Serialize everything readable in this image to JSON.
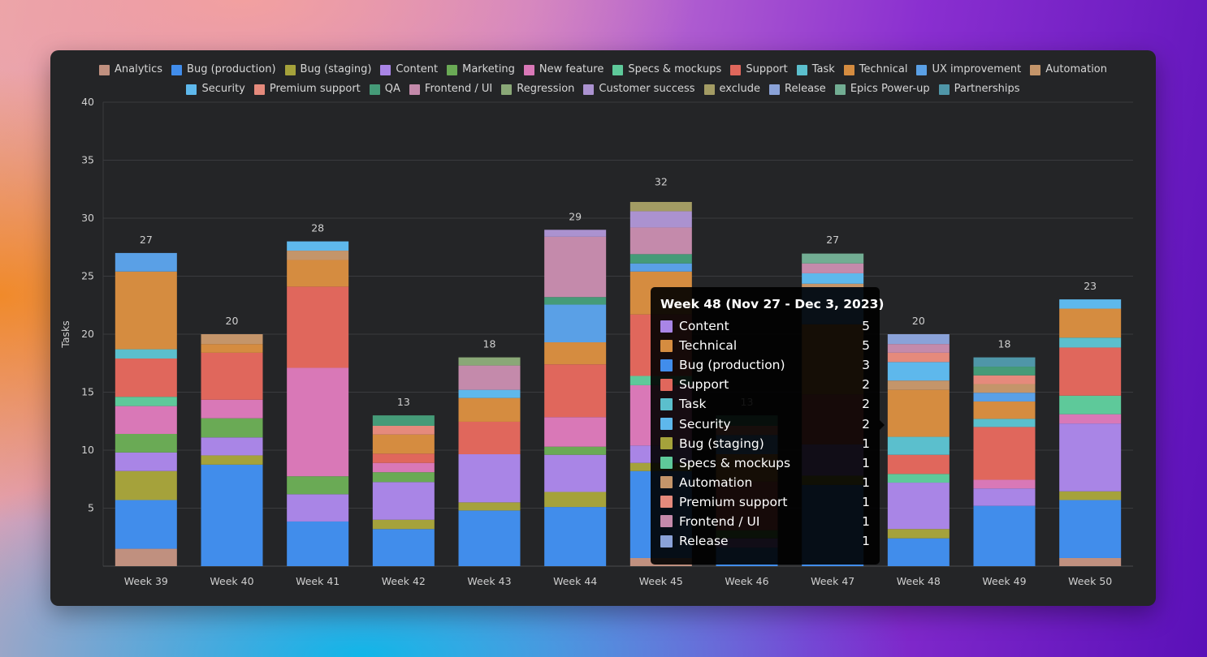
{
  "chart_data": {
    "type": "bar",
    "stacked": true,
    "ylabel": "Tasks",
    "ylim": [
      0,
      40
    ],
    "yticks": [
      5,
      10,
      15,
      20,
      25,
      30,
      35,
      40
    ],
    "grid": true,
    "legend_position": "top",
    "categories": [
      "Week 39",
      "Week 40",
      "Week 41",
      "Week 42",
      "Week 43",
      "Week 44",
      "Week 45",
      "Week 46",
      "Week 47",
      "Week 48",
      "Week 49",
      "Week 50"
    ],
    "totals": [
      27,
      20,
      28,
      13,
      18,
      29,
      32,
      13,
      27,
      20,
      18,
      23
    ],
    "series": [
      {
        "name": "Analytics",
        "color": "#c0907f",
        "values": [
          1.5,
          0,
          0,
          0,
          0,
          0,
          0.7,
          0,
          0,
          0,
          0,
          0.7
        ]
      },
      {
        "name": "Bug (production)",
        "color": "#418deb",
        "values": [
          4.2,
          8.75,
          3.85,
          3.2,
          4.8,
          5.1,
          7.5,
          1.6,
          7.0,
          2.4,
          5.2,
          5.0
        ]
      },
      {
        "name": "Bug (staging)",
        "color": "#a5a23b",
        "values": [
          2.5,
          0.8,
          0,
          0.8,
          0.7,
          1.3,
          0.7,
          0,
          0.8,
          0.8,
          0,
          0.75
        ]
      },
      {
        "name": "Content",
        "color": "#a985e6",
        "values": [
          1.6,
          1.55,
          2.35,
          3.25,
          4.15,
          3.2,
          1.5,
          0.8,
          2.7,
          4.0,
          1.5,
          5.85
        ]
      },
      {
        "name": "Marketing",
        "color": "#6aaa55",
        "values": [
          1.6,
          1.65,
          1.55,
          0.85,
          0,
          0.7,
          0,
          0.7,
          0,
          0,
          0,
          0
        ]
      },
      {
        "name": "New feature",
        "color": "#d978b7",
        "values": [
          2.4,
          1.6,
          9.35,
          0.8,
          0,
          2.55,
          5.2,
          0,
          0,
          0,
          0.75,
          0.8
        ]
      },
      {
        "name": "Specs & mockups",
        "color": "#5ec99a",
        "values": [
          0.8,
          0,
          0,
          0,
          0,
          0,
          0.8,
          0,
          0,
          0.75,
          0,
          1.6
        ]
      },
      {
        "name": "Support",
        "color": "#e0675c",
        "values": [
          3.3,
          4.05,
          7.0,
          0.8,
          2.8,
          4.55,
          5.3,
          4.2,
          4.3,
          1.65,
          4.55,
          4.15
        ]
      },
      {
        "name": "Task",
        "color": "#5bbfcd",
        "values": [
          0.8,
          0,
          0,
          0,
          0,
          0,
          0,
          0,
          0,
          1.55,
          0.7,
          0.85
        ]
      },
      {
        "name": "Technical",
        "color": "#d58c40",
        "values": [
          6.7,
          0.75,
          2.3,
          1.65,
          2.05,
          1.9,
          3.7,
          2.35,
          6.05,
          4.05,
          1.5,
          2.5
        ]
      },
      {
        "name": "UX improvement",
        "color": "#5aa0e6",
        "values": [
          1.6,
          0,
          0,
          0,
          0,
          3.25,
          0.7,
          1.65,
          3.2,
          0,
          0.75,
          0
        ]
      },
      {
        "name": "Automation",
        "color": "#c4956a",
        "values": [
          0,
          0.85,
          0.8,
          0,
          0,
          0,
          0,
          0,
          0.3,
          0.8,
          0.75,
          0
        ]
      },
      {
        "name": "Security",
        "color": "#5eb8ec",
        "values": [
          0,
          0,
          0.8,
          0,
          0.7,
          0,
          0,
          0,
          0.9,
          1.6,
          0,
          0.8
        ]
      },
      {
        "name": "Premium support",
        "color": "#e58a7c",
        "values": [
          0,
          0,
          0,
          0.75,
          0,
          0,
          0,
          0.8,
          0,
          0.8,
          0.75,
          0
        ]
      },
      {
        "name": "QA",
        "color": "#459b78",
        "values": [
          0,
          0,
          0,
          0.9,
          0,
          0.65,
          0.8,
          0.9,
          0,
          0,
          0.75,
          0
        ]
      },
      {
        "name": "Frontend / UI",
        "color": "#c48aab",
        "values": [
          0,
          0,
          0,
          0,
          2.1,
          5.2,
          2.3,
          0,
          0.85,
          0.75,
          0,
          0
        ]
      },
      {
        "name": "Regression",
        "color": "#8aa877",
        "values": [
          0,
          0,
          0,
          0,
          0.7,
          0,
          0,
          0,
          0,
          0,
          0,
          0
        ]
      },
      {
        "name": "Customer success",
        "color": "#ab92d0",
        "values": [
          0,
          0,
          0,
          0,
          0,
          0.6,
          1.4,
          0,
          0,
          0,
          0,
          0
        ]
      },
      {
        "name": "exclude",
        "color": "#a39c64",
        "values": [
          0,
          0,
          0,
          0,
          0,
          0,
          0.8,
          0,
          0,
          0,
          0,
          0
        ]
      },
      {
        "name": "Release",
        "color": "#8aa2d8",
        "values": [
          0,
          0,
          0,
          0,
          0,
          0,
          0,
          0,
          0,
          0.85,
          0,
          0
        ]
      },
      {
        "name": "Epics Power-up",
        "color": "#72ad93",
        "values": [
          0,
          0,
          0,
          0,
          0,
          0,
          0,
          0,
          0.85,
          0,
          0,
          0
        ]
      },
      {
        "name": "Partnerships",
        "color": "#4f96a8",
        "values": [
          0,
          0,
          0,
          0,
          0,
          0,
          0,
          0,
          0,
          0,
          0.8,
          0
        ]
      }
    ]
  },
  "legend": {
    "row1": [
      "Analytics",
      "Bug (production)",
      "Bug (staging)",
      "Content",
      "Marketing",
      "New feature",
      "Specs & mockups",
      "Support",
      "Task",
      "Technical",
      "UX improvement",
      "Automation"
    ],
    "row2": [
      "Security",
      "Premium support",
      "QA",
      "Frontend / UI",
      "Regression",
      "Customer success",
      "exclude",
      "Release",
      "Epics Power-up",
      "Partnerships"
    ]
  },
  "tooltip": {
    "title": "Week 48 (Nov 27 - Dec 3, 2023)",
    "items": [
      {
        "label": "Content",
        "value": "5",
        "color": "#a985e6"
      },
      {
        "label": "Technical",
        "value": "5",
        "color": "#d58c40"
      },
      {
        "label": "Bug (production)",
        "value": "3",
        "color": "#418deb"
      },
      {
        "label": "Support",
        "value": "2",
        "color": "#e0675c"
      },
      {
        "label": "Task",
        "value": "2",
        "color": "#5bbfcd"
      },
      {
        "label": "Security",
        "value": "2",
        "color": "#5eb8ec"
      },
      {
        "label": "Bug (staging)",
        "value": "1",
        "color": "#a5a23b"
      },
      {
        "label": "Specs & mockups",
        "value": "1",
        "color": "#5ec99a"
      },
      {
        "label": "Automation",
        "value": "1",
        "color": "#c4956a"
      },
      {
        "label": "Premium support",
        "value": "1",
        "color": "#e58a7c"
      },
      {
        "label": "Frontend / UI",
        "value": "1",
        "color": "#c48aab"
      },
      {
        "label": "Release",
        "value": "1",
        "color": "#8aa2d8"
      }
    ]
  }
}
